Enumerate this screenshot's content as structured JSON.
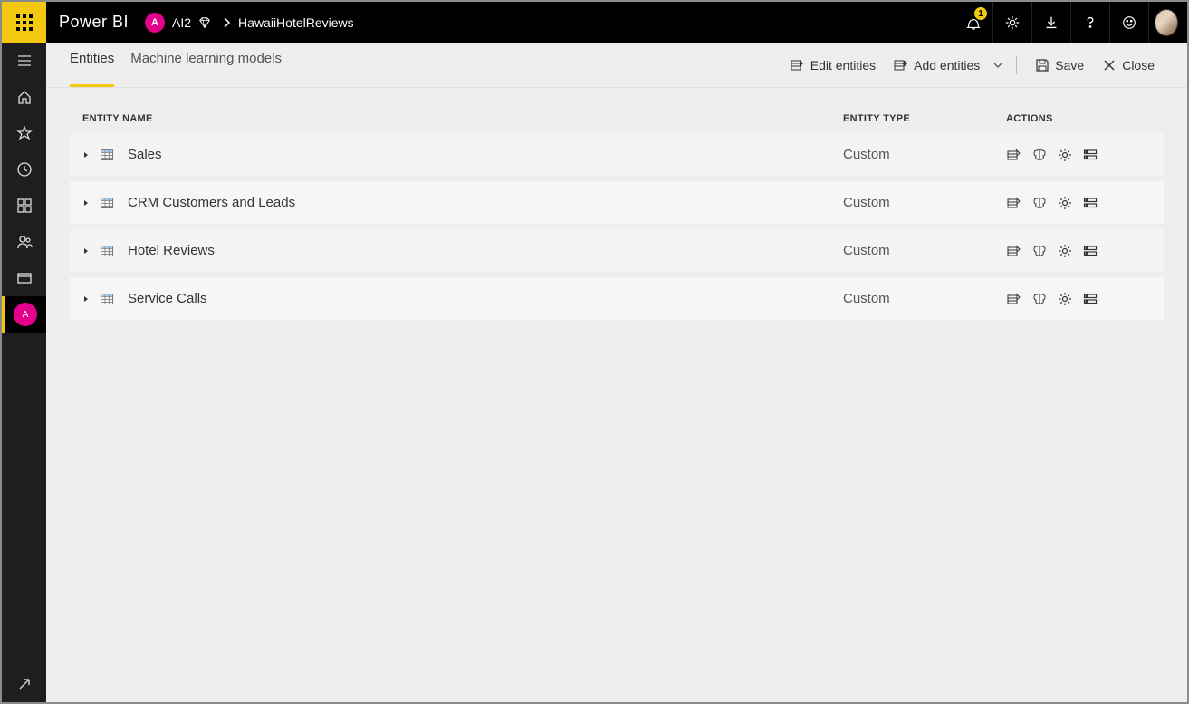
{
  "header": {
    "brand": "Power BI",
    "workspace_initial": "A",
    "workspace_name": "AI2",
    "breadcrumb_current": "HawaiiHotelReviews",
    "notification_count": "1"
  },
  "tabs": {
    "entities": "Entities",
    "ml_models": "Machine learning models"
  },
  "toolbar": {
    "edit_entities": "Edit entities",
    "add_entities": "Add entities",
    "save": "Save",
    "close": "Close"
  },
  "columns": {
    "name": "ENTITY NAME",
    "type": "ENTITY TYPE",
    "actions": "ACTIONS"
  },
  "entities": [
    {
      "name": "Sales",
      "type": "Custom"
    },
    {
      "name": "CRM Customers and Leads",
      "type": "Custom"
    },
    {
      "name": "Hotel Reviews",
      "type": "Custom"
    },
    {
      "name": "Service Calls",
      "type": "Custom"
    }
  ],
  "leftnav": {
    "workspace_initial": "A"
  }
}
